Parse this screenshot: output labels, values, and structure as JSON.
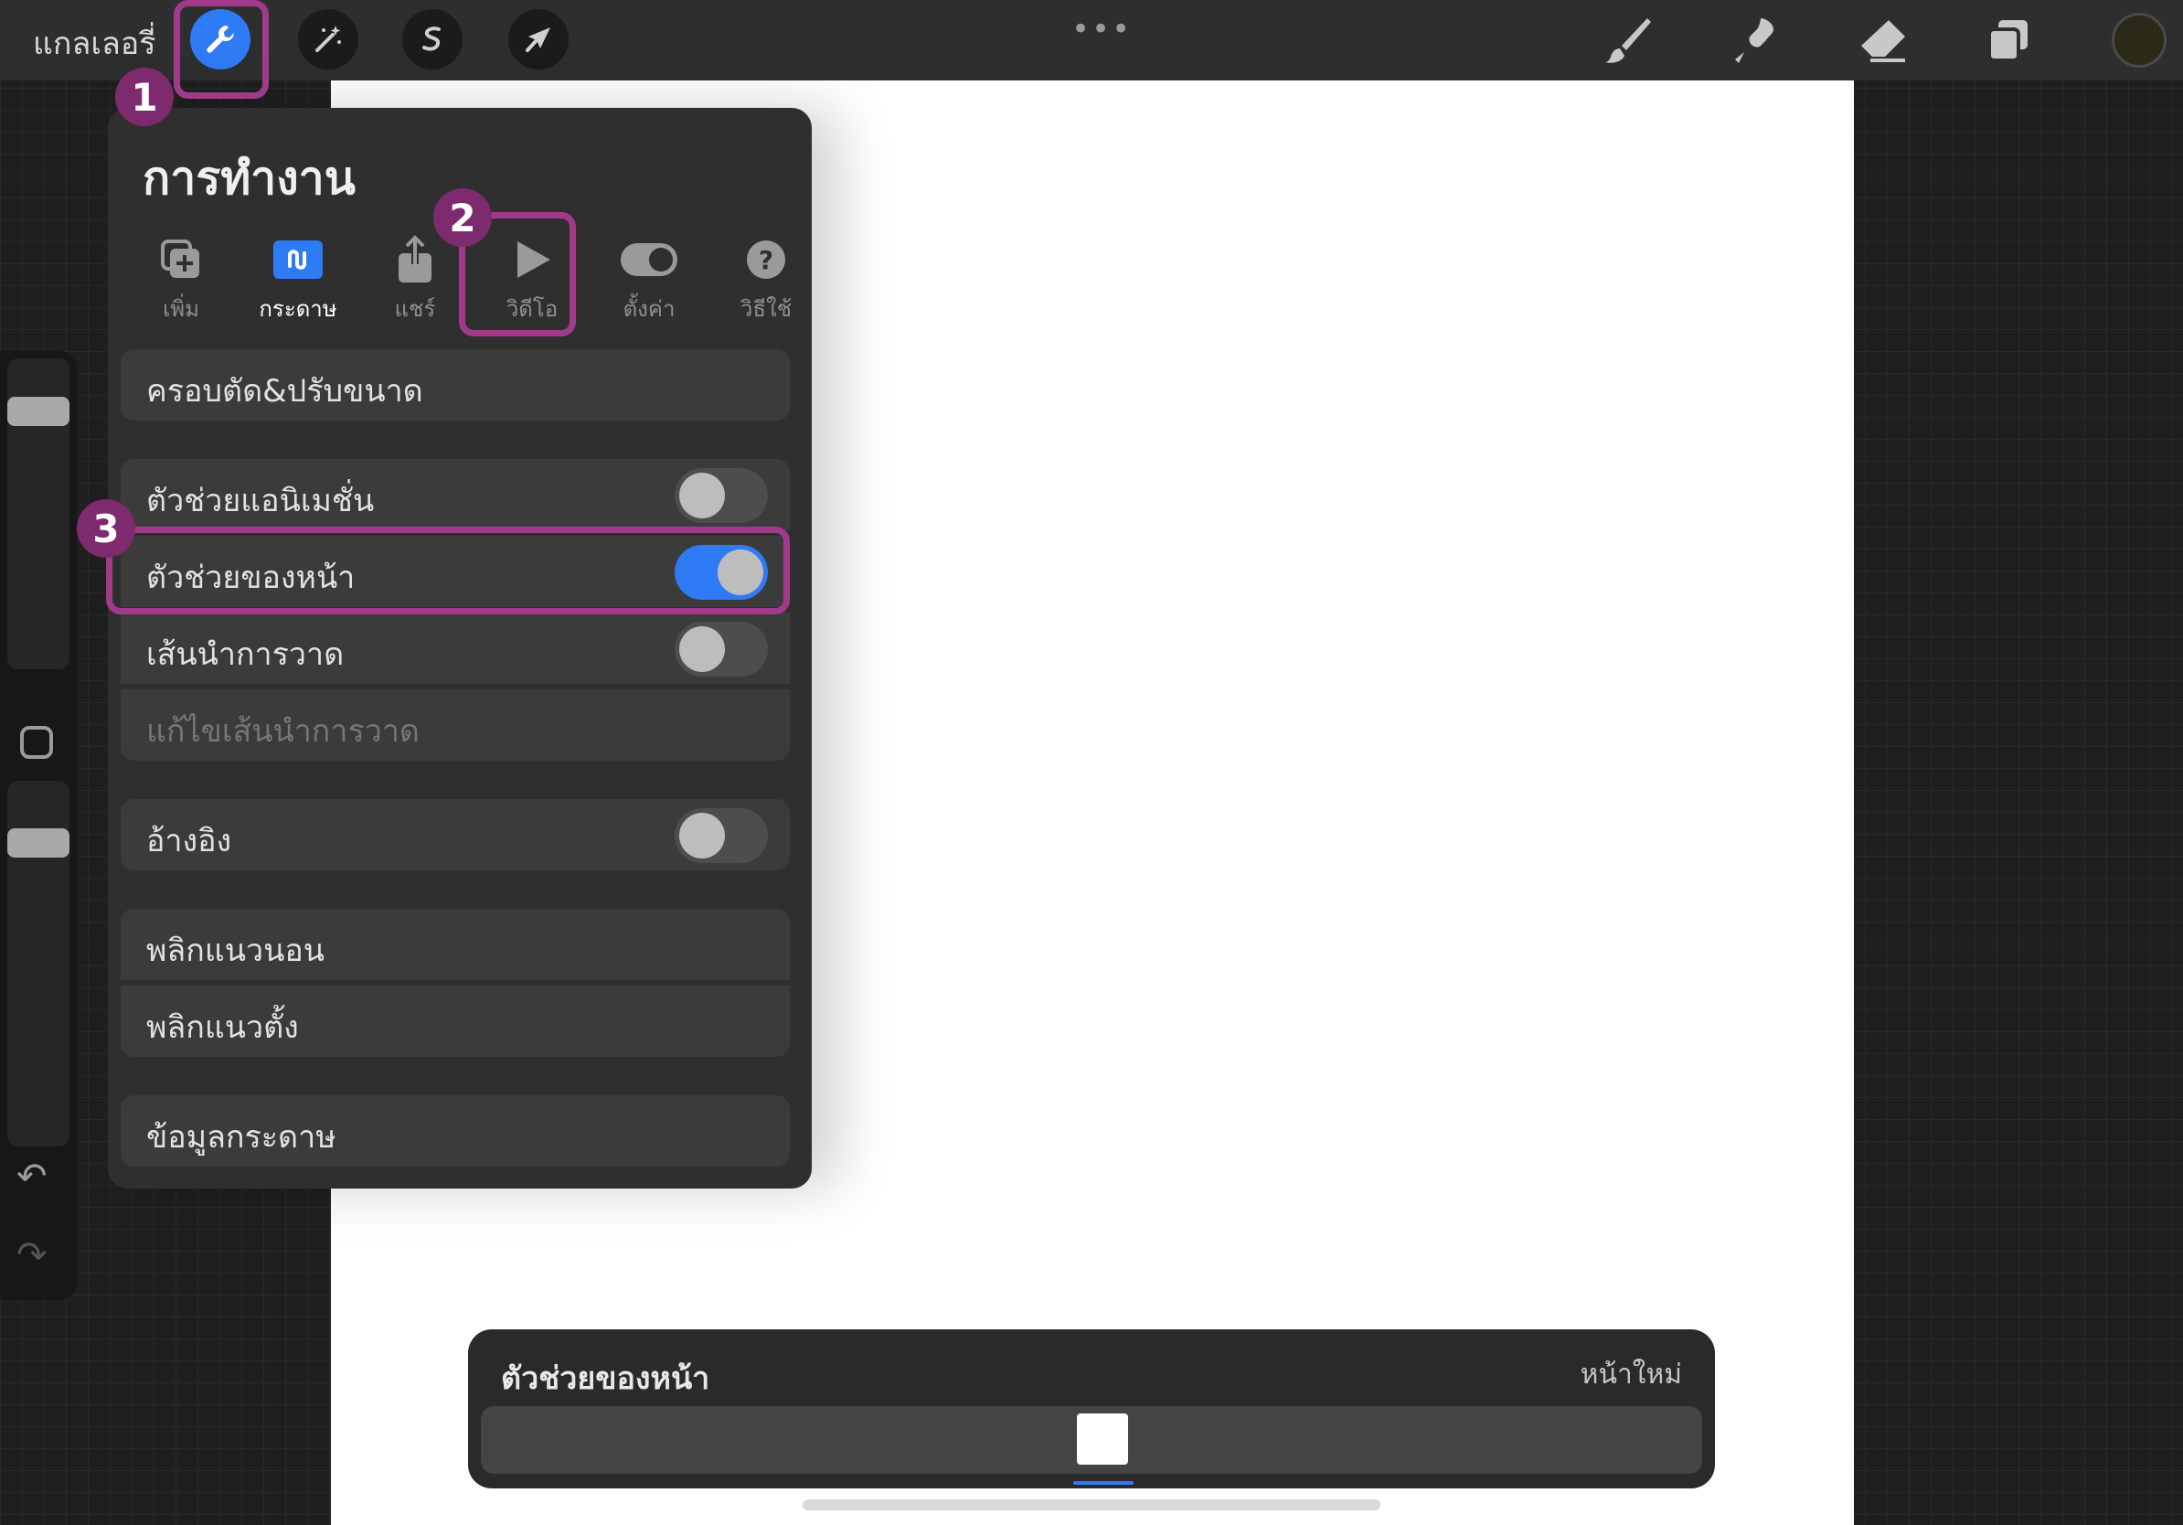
{
  "topbar": {
    "gallery_label": "แกลเลอรี่",
    "tools": [
      {
        "name": "actions",
        "icon": "wrench-icon",
        "active": true
      },
      {
        "name": "adjustments",
        "icon": "magic-wand-icon",
        "active": false
      },
      {
        "name": "selection",
        "icon": "selection-icon",
        "active": false
      },
      {
        "name": "transform",
        "icon": "arrow-cursor-icon",
        "active": false
      }
    ],
    "more_icon": "more-dots-icon",
    "right_tools": [
      "brush-icon",
      "smudge-icon",
      "eraser-icon",
      "layers-icon"
    ],
    "color_swatch": "#2b2a18"
  },
  "panel": {
    "title": "การทำงาน",
    "tabs": [
      {
        "label": "เพิ่ม",
        "icon": "add-icon",
        "active": false
      },
      {
        "label": "กระดาษ",
        "icon": "canvas-icon",
        "active": true
      },
      {
        "label": "แชร์",
        "icon": "share-icon",
        "active": false
      },
      {
        "label": "วิดีโอ",
        "icon": "play-icon",
        "active": false
      },
      {
        "label": "ตั้งค่า",
        "icon": "toggle-icon",
        "active": false
      },
      {
        "label": "วิธีใช้",
        "icon": "help-icon",
        "active": false
      }
    ],
    "rows": {
      "crop_resize": "ครอบตัด&ปรับขนาด",
      "animation_assist": "ตัวช่วยแอนิเมชั่น",
      "page_assist": "ตัวช่วยของหน้า",
      "drawing_guide": "เส้นนำการวาด",
      "edit_drawing_guide": "แก้ไขเส้นนำการวาด",
      "reference": "อ้างอิง",
      "flip_horizontal": "พลิกแนวนอน",
      "flip_vertical": "พลิกแนวตั้ง",
      "canvas_info": "ข้อมูลกระดาษ"
    },
    "toggles": {
      "animation_assist": false,
      "page_assist": true,
      "drawing_guide": false,
      "reference": false
    }
  },
  "annotations": {
    "step1": "1",
    "step2": "2",
    "step3": "3"
  },
  "pagebar": {
    "title": "ตัวช่วยของหน้า",
    "new_page": "หน้าใหม่"
  },
  "colors": {
    "accent": "#2f7bf6",
    "highlight": "#a23a8b",
    "badge": "#7e2a6f"
  }
}
